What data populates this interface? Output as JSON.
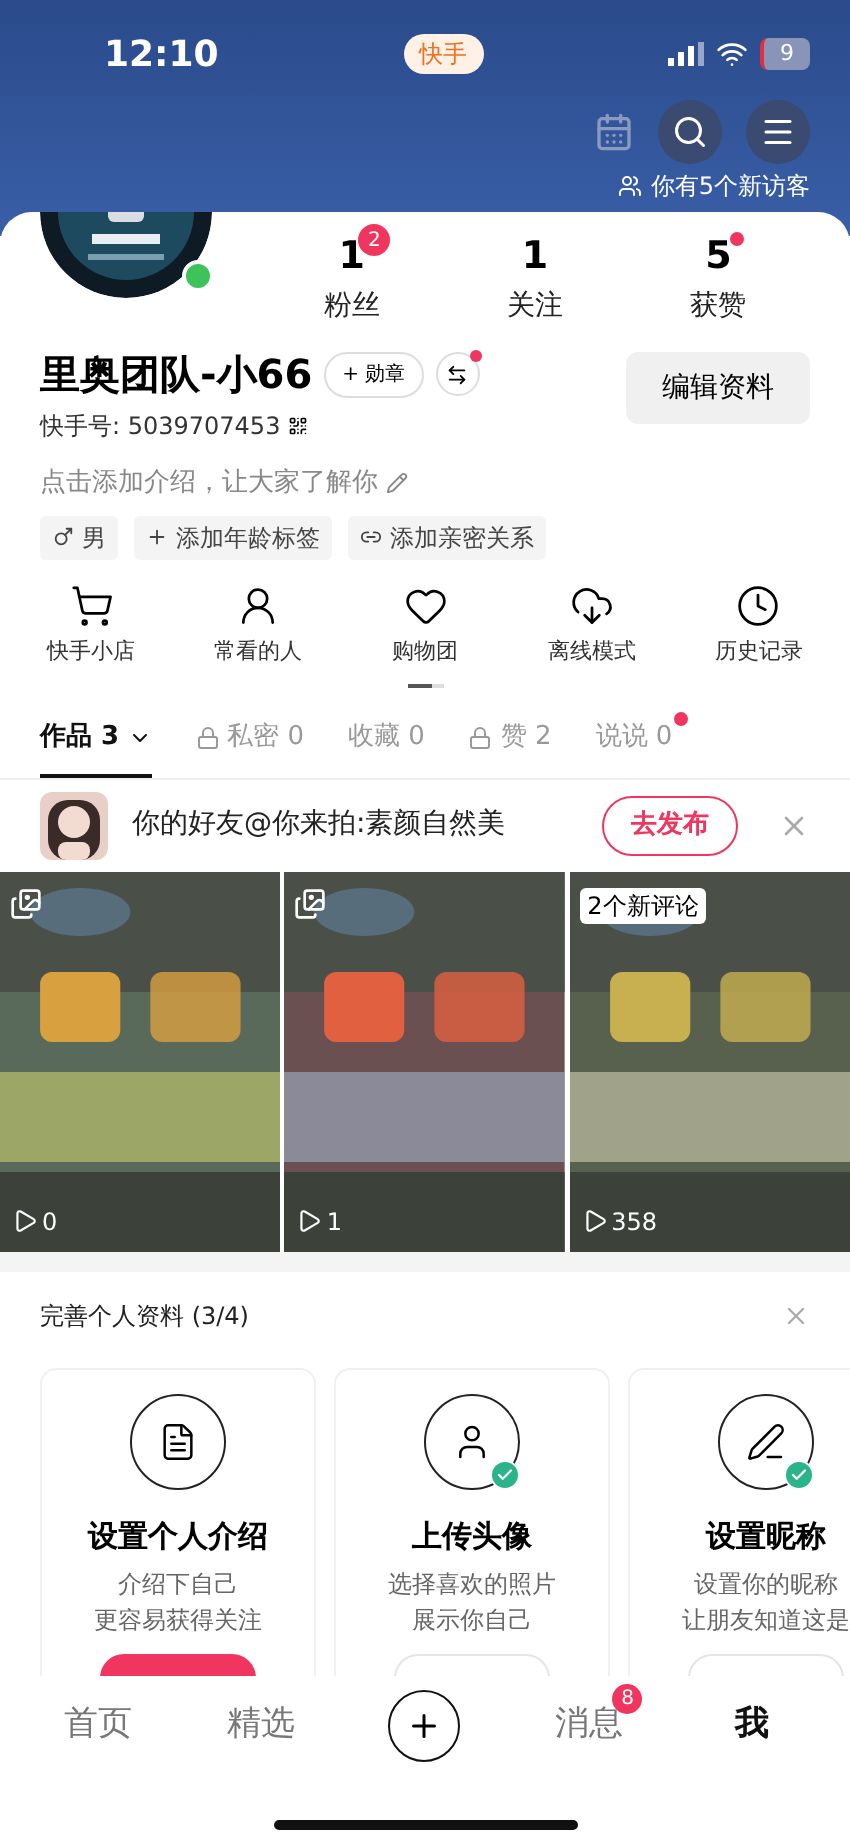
{
  "status_bar": {
    "time": "12:10",
    "app_badge": "快手",
    "battery": "9"
  },
  "header": {
    "visitors": "你有5个新访客"
  },
  "profile": {
    "online": true,
    "name": "里奥团队-小66",
    "medal_button": "+ 勋章",
    "switch_dot": true,
    "id": "快手号: 5039707453",
    "edit_button": "编辑资料",
    "intro": "点击添加介绍，让大家了解你"
  },
  "tags": [
    {
      "kind": "gender",
      "label": "男"
    },
    {
      "kind": "add",
      "label": "添加年龄标签"
    },
    {
      "kind": "relation",
      "label": "添加亲密关系"
    }
  ],
  "stats": [
    {
      "value": "1",
      "label": "粉丝",
      "badge": "2",
      "dot": false
    },
    {
      "value": "1",
      "label": "关注",
      "dot": false
    },
    {
      "value": "5",
      "label": "获赞",
      "dot": true
    }
  ],
  "quick_actions": [
    {
      "label": "快手小店"
    },
    {
      "label": "常看的人"
    },
    {
      "label": "购物团"
    },
    {
      "label": "离线模式"
    },
    {
      "label": "历史记录"
    }
  ],
  "tabs": [
    {
      "label": "作品 3",
      "selected": true,
      "locked": false,
      "dropdown": true,
      "dot": false
    },
    {
      "label": "私密 0",
      "selected": false,
      "locked": true,
      "dropdown": false,
      "dot": false
    },
    {
      "label": "收藏 0",
      "selected": false,
      "locked": false,
      "dropdown": false,
      "dot": false
    },
    {
      "label": "赞 2",
      "selected": false,
      "locked": true,
      "dropdown": false,
      "dot": false
    },
    {
      "label": "说说 0",
      "selected": false,
      "locked": false,
      "dropdown": false,
      "dot": true
    }
  ],
  "friend_prompt": {
    "text": "你的好友@你来拍:素颜自然美",
    "button": "去发布"
  },
  "works": [
    {
      "kind": "picture",
      "album": true,
      "views": "0"
    },
    {
      "kind": "picture",
      "album": true,
      "views": "1"
    },
    {
      "kind": "picture",
      "album": false,
      "comment_badge": "2个新评论",
      "views": "358"
    }
  ],
  "complete_profile": {
    "title": "完善个人资料 (3/4)",
    "cards": [
      {
        "title": "设置个人介绍",
        "lines": [
          "介绍下自己",
          "更容易获得关注"
        ],
        "done": false
      },
      {
        "title": "上传头像",
        "lines": [
          "选择喜欢的照片",
          "展示你自己"
        ],
        "done": true
      },
      {
        "title": "设置昵称",
        "lines": [
          "设置你的昵称",
          "让朋友知道这是"
        ],
        "done": true
      }
    ]
  },
  "nav": [
    {
      "kind": "text",
      "label": "首页",
      "selected": false
    },
    {
      "kind": "text",
      "label": "精选",
      "selected": false
    },
    {
      "kind": "plus"
    },
    {
      "kind": "text",
      "label": "消息",
      "badge": "8",
      "selected": false
    },
    {
      "kind": "text",
      "label": "我",
      "selected": true
    }
  ]
}
